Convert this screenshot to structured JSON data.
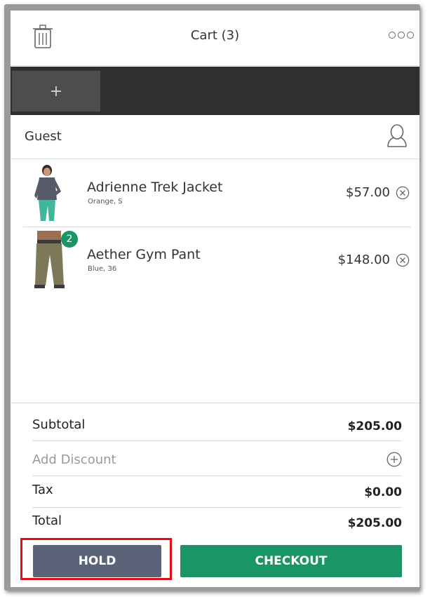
{
  "header": {
    "title": "Cart (3)",
    "trash_icon": "trash-icon",
    "more_icon": "more-options-icon"
  },
  "tabs": {
    "add_label": "+"
  },
  "customer": {
    "label": "Guest",
    "icon": "user-icon"
  },
  "items": [
    {
      "name": "Adrienne Trek Jacket",
      "options": "Orange, S",
      "price": "$57.00",
      "quantity": null,
      "image": "jacket-photo"
    },
    {
      "name": "Aether Gym Pant",
      "options": "Blue, 36",
      "price": "$148.00",
      "quantity": "2",
      "image": "pants-photo"
    }
  ],
  "totals": {
    "subtotal_label": "Subtotal",
    "subtotal_value": "$205.00",
    "discount_label": "Add Discount",
    "tax_label": "Tax",
    "tax_value": "$0.00",
    "total_label": "Total",
    "total_value": "$205.00"
  },
  "actions": {
    "hold_label": "HOLD",
    "checkout_label": "CHECKOUT"
  },
  "colors": {
    "accent_green": "#1a9565",
    "hold_gray": "#5a6378",
    "highlight_red": "#e0101a",
    "tabbar_dark": "#2f2f2f"
  }
}
